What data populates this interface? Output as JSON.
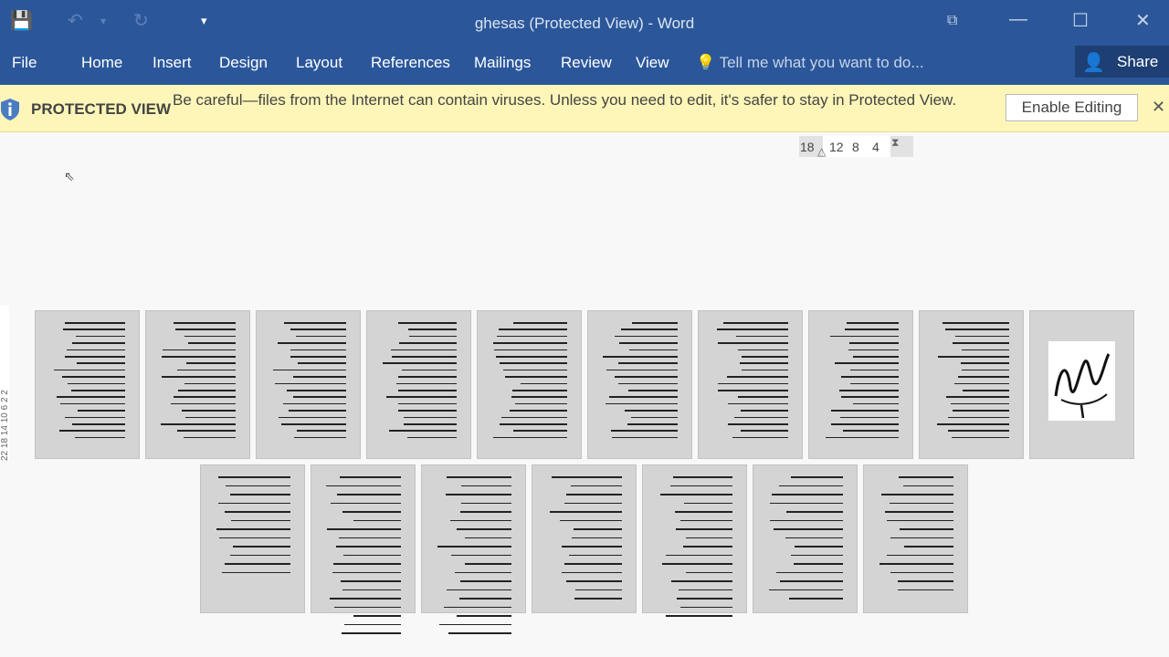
{
  "window": {
    "title": "ghesas (Protected View) - Word",
    "minimize": "—",
    "maximize": "☐",
    "close": "✕",
    "ribbon_display": "⧉"
  },
  "qat": {
    "save": "💾",
    "undo": "↶",
    "undo_dd": "▾",
    "redo": "↻",
    "customize": "▾"
  },
  "ribbon": {
    "tabs": [
      "File",
      "Home",
      "Insert",
      "Design",
      "Layout",
      "References",
      "Mailings",
      "Review",
      "View"
    ],
    "tell_me": "Tell me what you want to do...",
    "share": "Share"
  },
  "protected_view": {
    "label": "PROTECTED VIEW",
    "message": "Be careful—files from the Internet can contain viruses. Unless you need to edit, it's safer to stay in Protected View.",
    "enable_button": "Enable Editing",
    "close": "✕"
  },
  "ruler": {
    "numbers": [
      "18",
      "12",
      "8",
      "4"
    ]
  },
  "vertical_ruler": "22 18 14 10 6 2 2",
  "colors": {
    "ribbon": "#2b579a",
    "message_bar": "#fdf6b8"
  }
}
